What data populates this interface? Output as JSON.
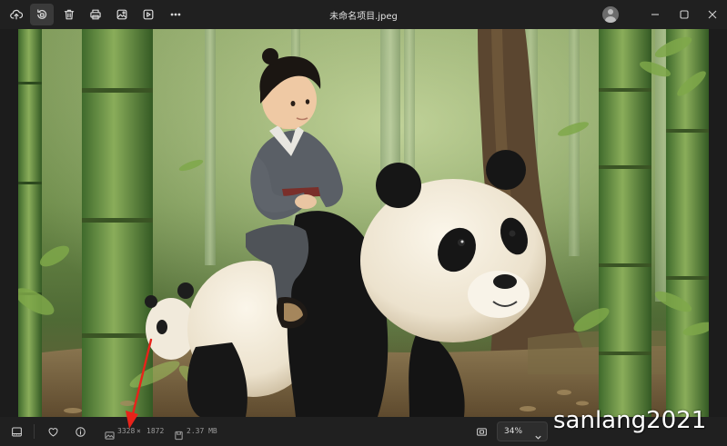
{
  "window": {
    "title": "未命名项目.jpeg"
  },
  "toolbar": {
    "icons": [
      "cloud-upload-icon",
      "rotate-icon",
      "delete-icon",
      "print-icon",
      "edit-image-icon",
      "video-icon",
      "more-icon"
    ],
    "active": "rotate-icon"
  },
  "window_controls": [
    "minimize-icon",
    "maximize-icon",
    "close-icon"
  ],
  "statusbar": {
    "width": "3328",
    "times": "×",
    "height": "1872",
    "file_size": "2.37 MB",
    "zoom": "34%"
  },
  "overlay": {
    "watermark": "sanlang2021",
    "annotation_color": "#e8231a"
  },
  "colors": {
    "titlebar_bg": "#202020",
    "bottombar_bg": "#202020"
  }
}
